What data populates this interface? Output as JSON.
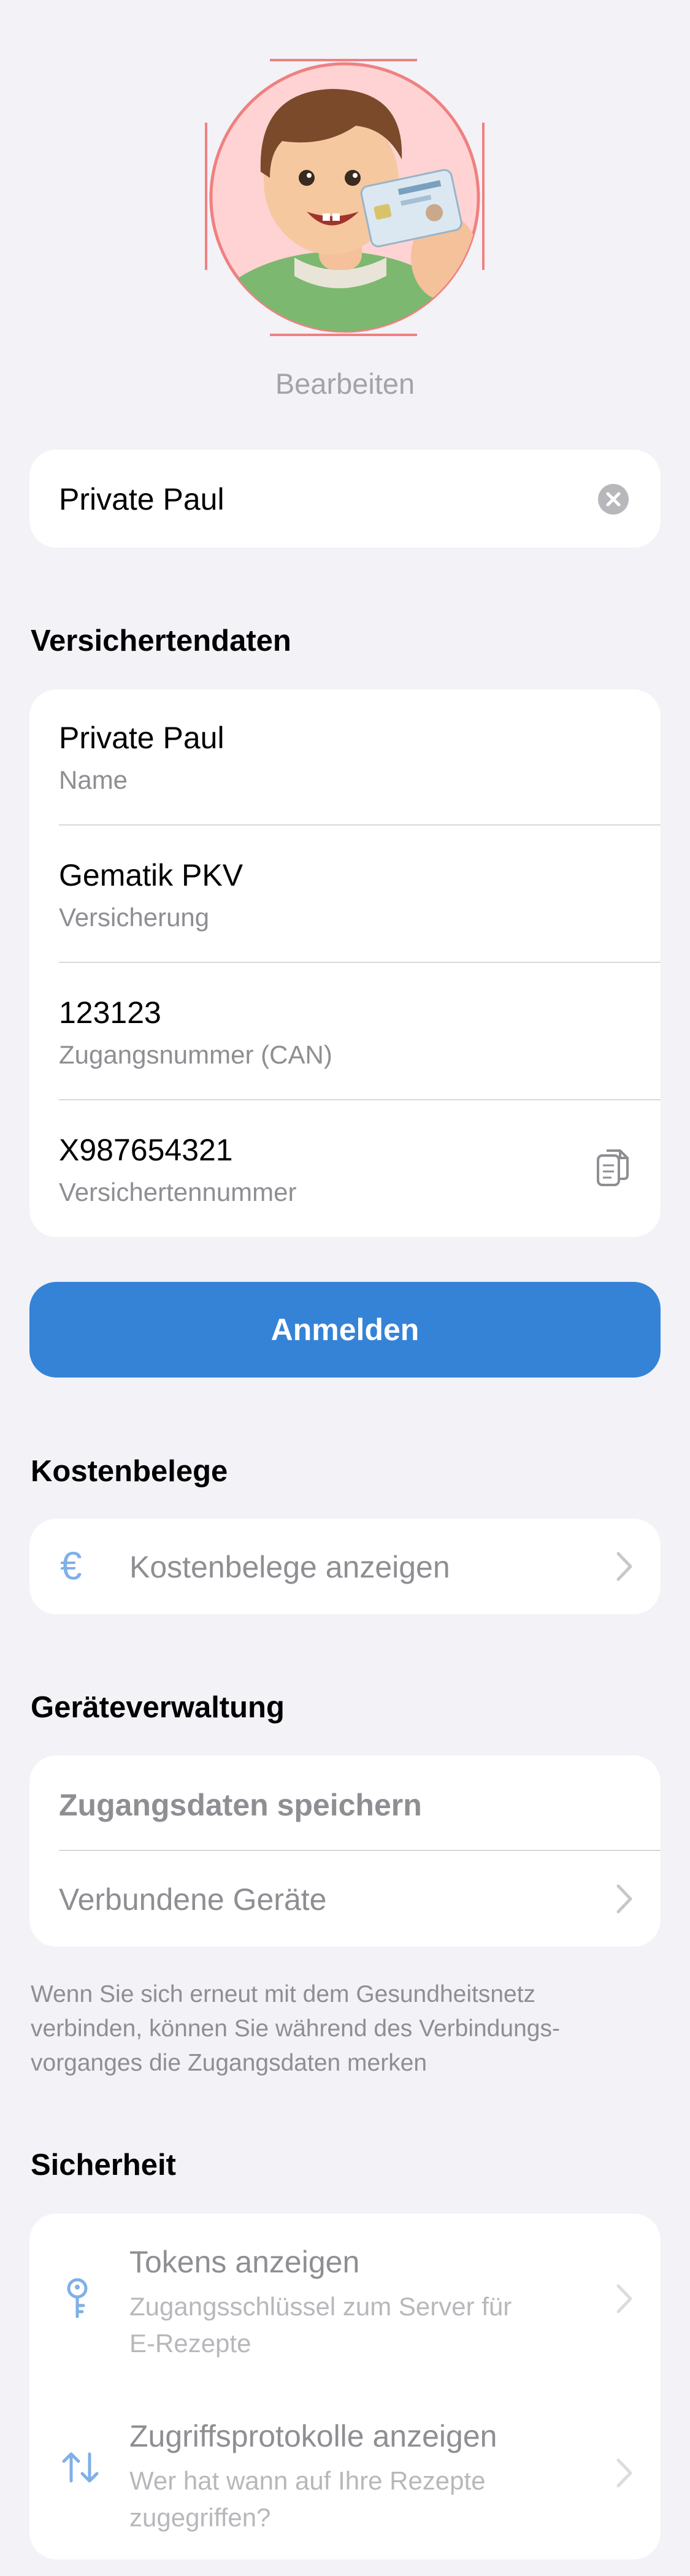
{
  "profile": {
    "edit_label": "Bearbeiten",
    "name_value": "Private Paul"
  },
  "insurance": {
    "section_title": "Versichertendaten",
    "rows": [
      {
        "value": "Private Paul",
        "label": "Name"
      },
      {
        "value": "Gematik PKV",
        "label": "Versicherung"
      },
      {
        "value": "123123",
        "label": "Zugangsnummer (CAN)"
      },
      {
        "value": "X987654321",
        "label": "Versichertennummer"
      }
    ]
  },
  "login_button": "Anmelden",
  "costs": {
    "section_title": "Kostenbelege",
    "item_label": "Kostenbelege anzeigen"
  },
  "devices": {
    "section_title": "Geräteverwaltung",
    "save_credentials": "Zugangsdaten speichern",
    "connected_devices": "Verbundene Geräte",
    "footnote_line1": "Wenn Sie sich erneut mit dem Gesundheitsnetz",
    "footnote_line2": "verbinden, können Sie während des Verbindungs-",
    "footnote_line3": "vorganges die Zugangsdaten merken"
  },
  "security": {
    "section_title": "Sicherheit",
    "tokens_title": "Tokens anzeigen",
    "tokens_sub_line1": "Zugangsschlüssel zum Server für",
    "tokens_sub_line2": "E-Rezepte",
    "logs_title": "Zugriffsprotokolle anzeigen",
    "logs_sub_line1": "Wer hat wann auf Ihre Rezepte",
    "logs_sub_line2": "zugegriffen?"
  },
  "colors": {
    "accent": "#3583d6",
    "background": "#f2f2f7",
    "avatar_bg": "#ffd3d3",
    "avatar_frame": "#f08080",
    "secondary_text": "#8e8e93"
  },
  "icons": {
    "clear": "clear-icon",
    "copy": "copy-icon",
    "euro": "euro-icon",
    "key": "key-icon",
    "arrows": "arrows-up-down-icon",
    "chevron": "chevron-right-icon"
  }
}
